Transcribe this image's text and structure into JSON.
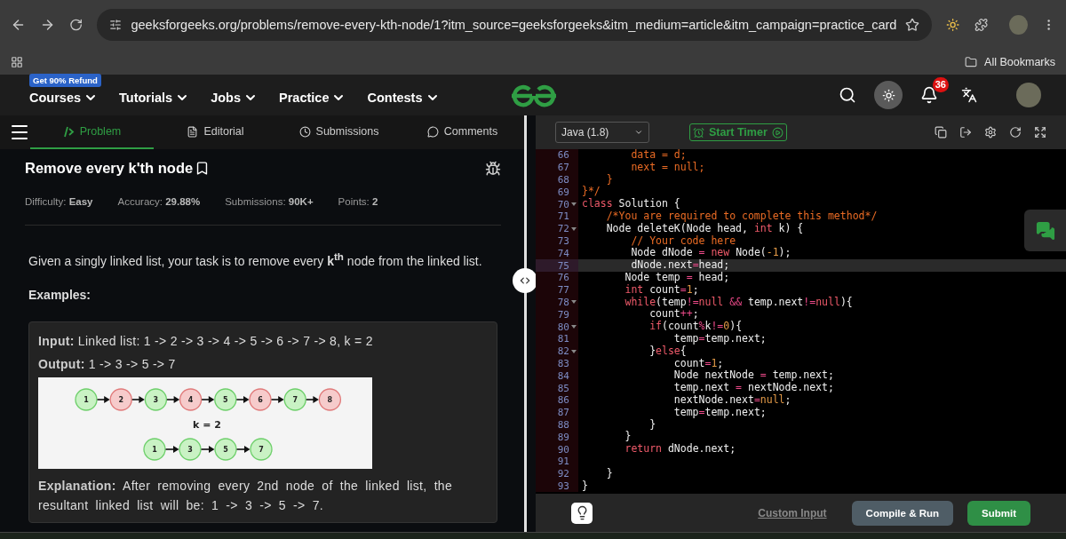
{
  "browser": {
    "url": "geeksforgeeks.org/problems/remove-every-kth-node/1?itm_source=geeksforgeeks&itm_medium=article&itm_campaign=practice_card",
    "bookmarks_label": "All Bookmarks"
  },
  "navbar": {
    "promo_badge": "Get 90% Refund",
    "menus": [
      "Courses",
      "Tutorials",
      "Jobs",
      "Practice",
      "Contests"
    ],
    "notification_count": "36"
  },
  "problem_tabs": [
    {
      "label": "Problem",
      "selected": true
    },
    {
      "label": "Editorial",
      "selected": false
    },
    {
      "label": "Submissions",
      "selected": false
    },
    {
      "label": "Comments",
      "selected": false
    }
  ],
  "problem": {
    "title": "Remove every k'th node",
    "meta": [
      "Difficulty: **Easy**",
      "Accuracy: **29.88%**",
      "Submissions: **90K+**",
      "Points: **2**"
    ],
    "statement": "Given a singly linked list, your task is to remove every **k**$^{th}$ node from the linked list.",
    "examples_heading": "Examples:",
    "example": {
      "input": "**Input:** Linked list: 1 -> 2 -> 3 -> 4 -> 5 -> 6 -> 7 -> 8, k = 2",
      "output": "**Output:** 1 -> 3 -> 5 -> 7",
      "diagram": {
        "top_nodes": [
          {
            "label": "1",
            "removed": false
          },
          {
            "label": "2",
            "removed": true
          },
          {
            "label": "3",
            "removed": false
          },
          {
            "label": "4",
            "removed": true
          },
          {
            "label": "5",
            "removed": false
          },
          {
            "label": "6",
            "removed": true
          },
          {
            "label": "7",
            "removed": false
          },
          {
            "label": "8",
            "removed": true
          }
        ],
        "caption": "k = 2",
        "bottom_nodes": [
          "1",
          "3",
          "5",
          "7"
        ]
      },
      "explanation": "**Explanation:** After removing every 2nd node of the linked list, the resultant linked list will be: 1 -> 3 -> 5 -> 7."
    }
  },
  "editor": {
    "language": "Java (1.8)",
    "timer": "Start Timer",
    "lines": [
      {
        "number": "66",
        "fold": false,
        "highlighted": false,
        "tokens": [
          {
            "text": "        data = d;",
            "kind": "comment"
          }
        ]
      },
      {
        "number": "67",
        "fold": false,
        "highlighted": false,
        "tokens": [
          {
            "text": "        next = null;",
            "kind": "comment"
          }
        ]
      },
      {
        "number": "68",
        "fold": false,
        "highlighted": false,
        "tokens": [
          {
            "text": "    }",
            "kind": "comment"
          }
        ]
      },
      {
        "number": "69",
        "fold": false,
        "highlighted": false,
        "tokens": [
          {
            "text": "}*/",
            "kind": "comment"
          }
        ]
      },
      {
        "number": "70",
        "fold": true,
        "highlighted": false,
        "tokens": [
          {
            "text": "class",
            "kind": "keyword"
          },
          {
            "text": " Solution {",
            "kind": "plain"
          }
        ]
      },
      {
        "number": "71",
        "fold": false,
        "highlighted": false,
        "tokens": [
          {
            "text": "    /*You are required to complete this method*/",
            "kind": "comment"
          }
        ]
      },
      {
        "number": "72",
        "fold": true,
        "highlighted": false,
        "tokens": [
          {
            "text": "    Node deleteK(Node head, ",
            "kind": "plain"
          },
          {
            "text": "int",
            "kind": "keyword"
          },
          {
            "text": " k) {",
            "kind": "plain"
          }
        ]
      },
      {
        "number": "73",
        "fold": false,
        "highlighted": false,
        "tokens": [
          {
            "text": "        // Your code here",
            "kind": "comment"
          }
        ]
      },
      {
        "number": "74",
        "fold": false,
        "highlighted": false,
        "tokens": [
          {
            "text": "        Node dNode ",
            "kind": "plain"
          },
          {
            "text": "=",
            "kind": "operator"
          },
          {
            "text": " new",
            "kind": "keyword"
          },
          {
            "text": " Node(",
            "kind": "plain"
          },
          {
            "text": "-1",
            "kind": "number"
          },
          {
            "text": ");",
            "kind": "plain"
          }
        ]
      },
      {
        "number": "75",
        "fold": false,
        "highlighted": true,
        "tokens": [
          {
            "text": "        dNode.next",
            "kind": "plain"
          },
          {
            "text": "=",
            "kind": "operator"
          },
          {
            "text": "head;",
            "kind": "plain"
          }
        ]
      },
      {
        "number": "76",
        "fold": false,
        "highlighted": false,
        "tokens": [
          {
            "text": "       Node temp ",
            "kind": "plain"
          },
          {
            "text": "=",
            "kind": "operator"
          },
          {
            "text": " head;",
            "kind": "plain"
          }
        ]
      },
      {
        "number": "77",
        "fold": false,
        "highlighted": false,
        "tokens": [
          {
            "text": "       int",
            "kind": "keyword"
          },
          {
            "text": " count",
            "kind": "plain"
          },
          {
            "text": "=",
            "kind": "operator"
          },
          {
            "text": "1",
            "kind": "number"
          },
          {
            "text": ";",
            "kind": "plain"
          }
        ]
      },
      {
        "number": "78",
        "fold": true,
        "highlighted": false,
        "tokens": [
          {
            "text": "       while",
            "kind": "keyword"
          },
          {
            "text": "(temp",
            "kind": "plain"
          },
          {
            "text": "!=",
            "kind": "operator"
          },
          {
            "text": "null",
            "kind": "keyword"
          },
          {
            "text": " &&",
            "kind": "operator"
          },
          {
            "text": " temp.next",
            "kind": "plain"
          },
          {
            "text": "!=",
            "kind": "operator"
          },
          {
            "text": "null",
            "kind": "keyword"
          },
          {
            "text": "){",
            "kind": "plain"
          }
        ]
      },
      {
        "number": "79",
        "fold": false,
        "highlighted": false,
        "tokens": [
          {
            "text": "           count",
            "kind": "plain"
          },
          {
            "text": "++",
            "kind": "operator"
          },
          {
            "text": ";",
            "kind": "plain"
          }
        ]
      },
      {
        "number": "80",
        "fold": true,
        "highlighted": false,
        "tokens": [
          {
            "text": "           if",
            "kind": "keyword"
          },
          {
            "text": "(count",
            "kind": "plain"
          },
          {
            "text": "%",
            "kind": "operator"
          },
          {
            "text": "k",
            "kind": "plain"
          },
          {
            "text": "!=",
            "kind": "operator"
          },
          {
            "text": "0",
            "kind": "number"
          },
          {
            "text": "){",
            "kind": "plain"
          }
        ]
      },
      {
        "number": "81",
        "fold": false,
        "highlighted": false,
        "tokens": [
          {
            "text": "               temp",
            "kind": "plain"
          },
          {
            "text": "=",
            "kind": "operator"
          },
          {
            "text": "temp.next;",
            "kind": "plain"
          }
        ]
      },
      {
        "number": "82",
        "fold": true,
        "highlighted": false,
        "tokens": [
          {
            "text": "           }",
            "kind": "plain"
          },
          {
            "text": "else",
            "kind": "keyword"
          },
          {
            "text": "{",
            "kind": "plain"
          }
        ]
      },
      {
        "number": "83",
        "fold": false,
        "highlighted": false,
        "tokens": [
          {
            "text": "               count",
            "kind": "plain"
          },
          {
            "text": "=",
            "kind": "operator"
          },
          {
            "text": "1",
            "kind": "number"
          },
          {
            "text": ";",
            "kind": "plain"
          }
        ]
      },
      {
        "number": "84",
        "fold": false,
        "highlighted": false,
        "tokens": [
          {
            "text": "               Node nextNode ",
            "kind": "plain"
          },
          {
            "text": "=",
            "kind": "operator"
          },
          {
            "text": " temp.next;",
            "kind": "plain"
          }
        ]
      },
      {
        "number": "85",
        "fold": false,
        "highlighted": false,
        "tokens": [
          {
            "text": "               temp.next ",
            "kind": "plain"
          },
          {
            "text": "=",
            "kind": "operator"
          },
          {
            "text": " nextNode.next;",
            "kind": "plain"
          }
        ]
      },
      {
        "number": "86",
        "fold": false,
        "highlighted": false,
        "tokens": [
          {
            "text": "               nextNode.next",
            "kind": "plain"
          },
          {
            "text": "=",
            "kind": "operator"
          },
          {
            "text": "null",
            "kind": "number"
          },
          {
            "text": ";",
            "kind": "plain"
          }
        ]
      },
      {
        "number": "87",
        "fold": false,
        "highlighted": false,
        "tokens": [
          {
            "text": "               temp",
            "kind": "plain"
          },
          {
            "text": "=",
            "kind": "operator"
          },
          {
            "text": "temp.next;",
            "kind": "plain"
          }
        ]
      },
      {
        "number": "88",
        "fold": false,
        "highlighted": false,
        "tokens": [
          {
            "text": "           }",
            "kind": "plain"
          }
        ]
      },
      {
        "number": "89",
        "fold": false,
        "highlighted": false,
        "tokens": [
          {
            "text": "       }",
            "kind": "plain"
          }
        ]
      },
      {
        "number": "90",
        "fold": false,
        "highlighted": false,
        "tokens": [
          {
            "text": "       return",
            "kind": "keyword"
          },
          {
            "text": " dNode.next;",
            "kind": "plain"
          }
        ]
      },
      {
        "number": "91",
        "fold": false,
        "highlighted": false
      },
      {
        "number": "92",
        "fold": false,
        "highlighted": false,
        "tokens": [
          {
            "text": "    }",
            "kind": "plain"
          }
        ]
      },
      {
        "number": "93",
        "fold": false,
        "highlighted": false,
        "tokens": [
          {
            "text": "}",
            "kind": "plain"
          }
        ]
      }
    ],
    "custom_input": "Custom Input",
    "buttons": [
      {
        "label": "Compile & Run",
        "kind": "secondary"
      },
      {
        "label": "Submit",
        "kind": "primary"
      }
    ]
  }
}
